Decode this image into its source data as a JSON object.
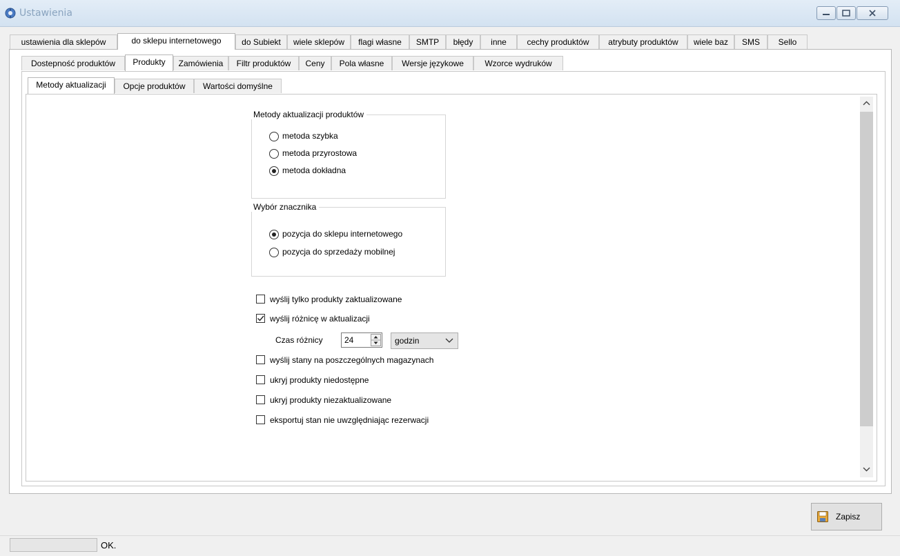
{
  "window": {
    "title": "Ustawienia"
  },
  "tabs_level1": [
    {
      "label": "ustawienia dla sklepów"
    },
    {
      "label": "do sklepu internetowego",
      "active": true
    },
    {
      "label": "do Subiekt"
    },
    {
      "label": "wiele sklepów"
    },
    {
      "label": "flagi własne"
    },
    {
      "label": "SMTP"
    },
    {
      "label": "błędy"
    },
    {
      "label": "inne"
    },
    {
      "label": "cechy produktów"
    },
    {
      "label": "atrybuty produktów"
    },
    {
      "label": "wiele baz"
    },
    {
      "label": "SMS"
    },
    {
      "label": "Sello"
    }
  ],
  "tabs_level2": [
    {
      "label": "Dostepność produktów"
    },
    {
      "label": "Produkty",
      "active": true
    },
    {
      "label": "Zamówienia"
    },
    {
      "label": "Filtr produktów"
    },
    {
      "label": "Ceny"
    },
    {
      "label": "Pola własne"
    },
    {
      "label": "Wersje językowe"
    },
    {
      "label": "Wzorce wydruków"
    }
  ],
  "tabs_level3": [
    {
      "label": "Metody aktualizacji",
      "active": true
    },
    {
      "label": "Opcje produktów"
    },
    {
      "label": "Wartości domyślne"
    }
  ],
  "update_methods": {
    "title": "Metody aktualizacji produktów",
    "options": [
      {
        "label": "metoda szybka",
        "checked": false
      },
      {
        "label": "metoda przyrostowa",
        "checked": false
      },
      {
        "label": "metoda dokładna",
        "checked": true
      }
    ]
  },
  "marker_choice": {
    "title": "Wybór znacznika",
    "options": [
      {
        "label": "pozycja do sklepu internetowego",
        "checked": true
      },
      {
        "label": "pozycja do sprzedaży mobilnej",
        "checked": false
      }
    ]
  },
  "checkboxes": [
    {
      "label": "wyślij tylko produkty zaktualizowane",
      "checked": false
    },
    {
      "label": "wyślij różnicę w aktualizacji",
      "checked": true
    },
    {
      "label": "wyślij stany na poszczególnych magazynach",
      "checked": false
    },
    {
      "label": "ukryj produkty niedostępne",
      "checked": false
    },
    {
      "label": "ukryj produkty niezaktualizowane",
      "checked": false
    },
    {
      "label": "eksportuj stan nie uwzględniając rezerwacji",
      "checked": false
    }
  ],
  "diff_time": {
    "label": "Czas różnicy",
    "value": "24",
    "unit": "godzin"
  },
  "save_button": {
    "label": "Zapisz"
  },
  "status": {
    "text": "OK."
  }
}
